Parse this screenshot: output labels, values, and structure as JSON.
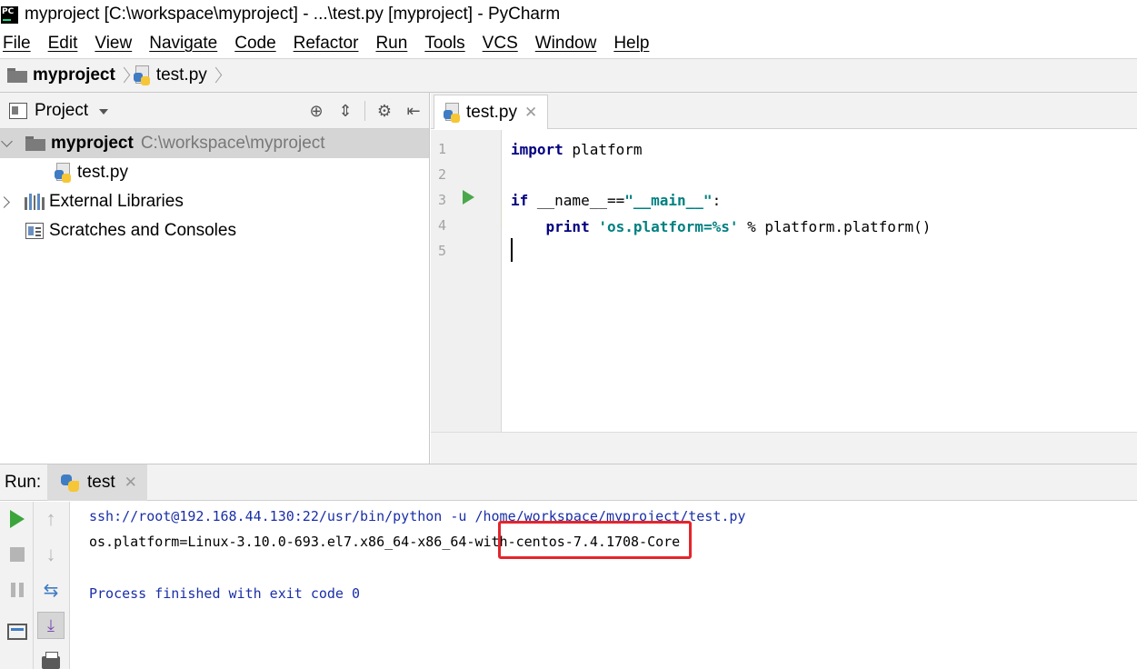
{
  "window": {
    "app_icon_label": "PC",
    "title": "myproject [C:\\workspace\\myproject] - ...\\test.py [myproject] - PyCharm"
  },
  "menu": [
    "File",
    "Edit",
    "View",
    "Navigate",
    "Code",
    "Refactor",
    "Run",
    "Tools",
    "VCS",
    "Window",
    "Help"
  ],
  "breadcrumb": {
    "project": "myproject",
    "file": "test.py"
  },
  "project_panel": {
    "title": "Project",
    "tree": {
      "root_name": "myproject",
      "root_path": "C:\\workspace\\myproject",
      "file": "test.py",
      "external_libraries": "External Libraries",
      "scratches": "Scratches and Consoles"
    }
  },
  "editor": {
    "tab_label": "test.py",
    "line_numbers": [
      "1",
      "2",
      "3",
      "4",
      "5"
    ],
    "code": {
      "l1_kw": "import",
      "l1_rest": " platform",
      "l3_kw": "if",
      "l3_mid": " __name__==",
      "l3_str": "\"__main__\"",
      "l3_end": ":",
      "l4_indent": "    ",
      "l4_kw": "print",
      "l4_sp": " ",
      "l4_str": "'os.platform=%s'",
      "l4_rest": " % platform.platform()"
    }
  },
  "run_panel": {
    "label": "Run:",
    "tab_label": "test",
    "console": {
      "command": "ssh://root@192.168.44.130:22/usr/bin/python -u /home/workspace/myproject/test.py",
      "output": "os.platform=Linux-3.10.0-693.el7.x86_64-x86_64-with-centos-7.4.1708-Core",
      "exit_message": "Process finished with exit code 0"
    }
  },
  "colors": {
    "keyword": "#000080",
    "string": "#008080",
    "console_blue": "#1a2fa8",
    "highlight_red": "#e5242b",
    "run_green": "#3ba53b"
  }
}
